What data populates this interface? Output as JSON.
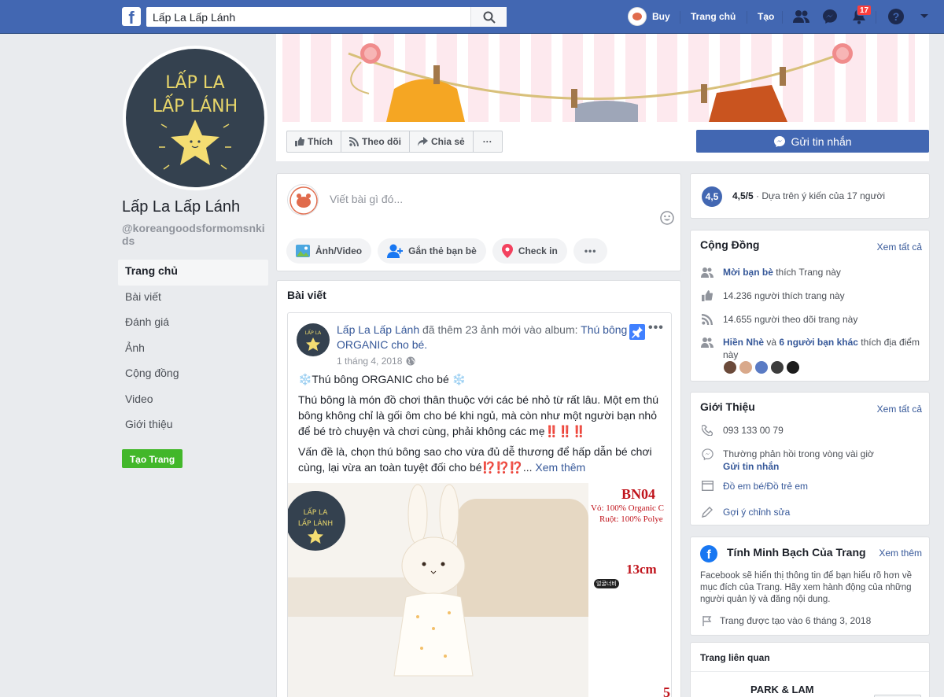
{
  "topbar": {
    "search_value": "Lấp La Lấp Lánh",
    "user_name": "Buy",
    "home_label": "Trang chủ",
    "create_label": "Tạo",
    "notification_count": "17"
  },
  "page": {
    "name": "Lấp La Lấp Lánh",
    "handle": "@koreangoodsformomsnkids",
    "logo_line1": "LẤP LA",
    "logo_line2": "LẤP LÁNH"
  },
  "left_nav": {
    "items": [
      "Trang chủ",
      "Bài viết",
      "Đánh giá",
      "Ảnh",
      "Cộng đồng",
      "Video",
      "Giới thiệu"
    ],
    "create_page": "Tạo Trang"
  },
  "actions": {
    "like": "Thích",
    "follow": "Theo dõi",
    "share": "Chia sẻ",
    "more": "···",
    "message": "Gửi tin nhắn"
  },
  "composer": {
    "placeholder": "Viết bài gì đó...",
    "photo_video": "Ảnh/Video",
    "tag_friends": "Gắn thẻ bạn bè",
    "check_in": "Check in",
    "more": "•••"
  },
  "posts": {
    "title": "Bài viết",
    "post": {
      "author": "Lấp La Lấp Lánh",
      "action": " đã thêm 23 ảnh mới vào album: ",
      "album": "Thú bông ORGANIC cho bé.",
      "date": "1 tháng 4, 2018",
      "line_title": "❄️Thú bông ORGANIC cho bé ❄️",
      "para1": "Thú bông là món đồ chơi thân thuộc với các bé nhỏ từ rất lâu. Một em thú bông không chỉ là gối ôm cho bé khi ngủ, mà còn như một người bạn nhỏ để bé trò chuyện và chơi cùng, phải không các mẹ",
      "para1_emoji": "‼️‼️‼️",
      "para2": "Vấn đề là, chọn thú bông sao cho vừa đủ dễ thương để hấp dẫn bé chơi cùng, lại vừa an toàn tuyệt đối cho bé",
      "para2_emoji": "⁉️⁉️⁉️",
      "see_more": "Xem thêm",
      "image_code": "BN04",
      "image_line1": "Vỏ: 100% Organic C",
      "image_line2": "Ruột: 100% Polye",
      "image_size": "13cm",
      "image_tag": "얼굴너비",
      "image_number": "5"
    }
  },
  "rating": {
    "score": "4,5",
    "score_text": "4,5/5",
    "based_on": " · Dựa trên ý kiến của 17 người"
  },
  "community": {
    "title": "Cộng Đồng",
    "see_all": "Xem tất cả",
    "invite_link": "Mời bạn bè",
    "invite_rest": " thích Trang này",
    "likes": "14.236 người thích trang này",
    "follows": "14.655 người theo dõi trang này",
    "friend1": "Hiền Nhè",
    "friend_and": " và ",
    "friend_others": "6 người bạn khác",
    "friend_rest": " thích địa điểm này"
  },
  "about": {
    "title": "Giới Thiệu",
    "see_all": "Xem tất cả",
    "phone": "093 133 00 79",
    "response": "Thường phản hồi trong vòng vài giờ",
    "send_message": "Gửi tin nhắn",
    "category": "Đồ em bé/Đồ trẻ em",
    "suggest_edit": "Gợi ý chỉnh sửa"
  },
  "transparency": {
    "title": "Tính Minh Bạch Của Trang",
    "see_more": "Xem thêm",
    "description": "Facebook sẽ hiển thị thông tin để bạn hiểu rõ hơn về mục đích của Trang. Hãy xem hành động của những người quản lý và đăng nội dung.",
    "created": "Trang được tạo vào 6 tháng 3, 2018"
  },
  "related": {
    "title": "Trang liên quan",
    "item1": "PARK & LAM"
  },
  "colors": {
    "brand": "#4267b2",
    "link": "#365899",
    "create_green": "#42b72a",
    "background": "#e9ebee"
  }
}
